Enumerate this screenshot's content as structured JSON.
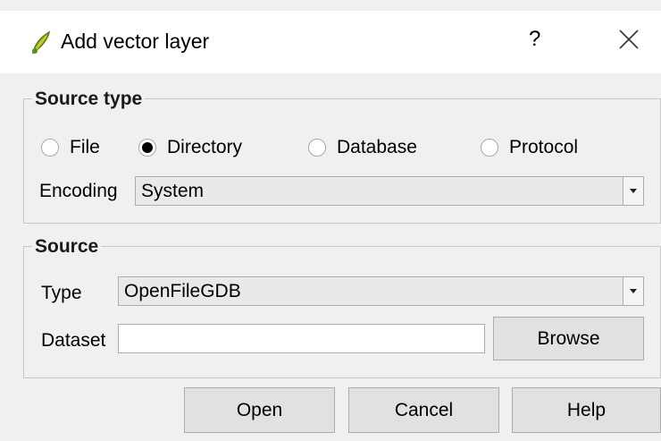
{
  "window": {
    "title": "Add vector layer",
    "help_label": "?"
  },
  "source_type": {
    "heading": "Source type",
    "options": [
      "File",
      "Directory",
      "Database",
      "Protocol"
    ],
    "selected": "Directory",
    "encoding_label": "Encoding",
    "encoding_value": "System"
  },
  "source": {
    "heading": "Source",
    "type_label": "Type",
    "type_value": "OpenFileGDB",
    "dataset_label": "Dataset",
    "dataset_value": "",
    "browse_label": "Browse"
  },
  "buttons": {
    "open": "Open",
    "cancel": "Cancel",
    "help": "Help"
  }
}
